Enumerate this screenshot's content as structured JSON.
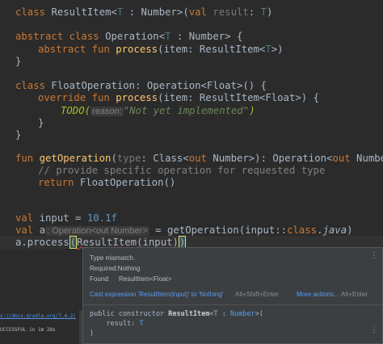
{
  "code": {
    "l1": {
      "kw1": "class",
      "name": "ResultItem",
      "lt": "<",
      "tp": "T",
      "colon": " : ",
      "bound": "Number",
      "gt": ">(",
      "kw2": "val",
      "param": " result",
      "ptype_sep": ": ",
      "ptype": "T",
      "close": ")"
    },
    "l2": {
      "kw": "abstract class",
      "name": "Operation",
      "lt": "<",
      "tp": "T",
      "rest": " : Number> {"
    },
    "l3": {
      "kw": "abstract fun",
      "fn": "process",
      "open": "(item: ResultItem<",
      "tp": "T",
      "close": ">)"
    },
    "l4": {
      "text": "}"
    },
    "l5": {
      "kw": "class",
      "text": " FloatOperation: Operation<Float>() {"
    },
    "l6": {
      "kw": "override fun",
      "fn": "process",
      "rest": "(item: ResultItem<Float>) {"
    },
    "l7": {
      "todo": "TODO(",
      "hint": "reason:",
      "str": "\"Not yet implemented\"",
      "close": ")"
    },
    "l8": {
      "text": "}"
    },
    "l9": {
      "text": "}"
    },
    "l10": {
      "kw": "fun",
      "fn": "getOperation",
      "open": "(",
      "param": "type",
      "mid": ": Class<",
      "kw2": "out",
      "mid2": " Number>): Operation<",
      "kw3": "out",
      "rest": " Number> -"
    },
    "l11": {
      "cmt": "// provide specific operation for requested type"
    },
    "l12": {
      "kw": "return",
      "rest": " FloatOperation()"
    },
    "l13": {
      "kw": "val",
      "rest": " input = ",
      "num": "10.1f"
    },
    "l14": {
      "kw": "val",
      "rest": " a",
      "hint": ": Operation<out Number>",
      "eq": " = getOperation(input::",
      "kw2": "class",
      "dot": ".",
      "it": "java",
      "close": ")"
    },
    "l15": {
      "pre": "a.process",
      "open": "(",
      "squig": "ResultItem(input)",
      "close": ")"
    }
  },
  "popup": {
    "title": "Type mismatch.",
    "required": "Required:Nothing",
    "found_label": "Found:",
    "found_value": "ResultItem<Float>",
    "action": "Cast expression 'ResultItem(input)' to 'Nothing'",
    "action_shortcut": "Alt+Shift+Enter",
    "more": "More actions...",
    "more_shortcut": "Alt+Enter",
    "sig1_pre": "public constructor ",
    "sig1_name": "ResultItem",
    "sig1_tp": "<T : ",
    "sig1_bound": "Number",
    "sig1_end": ">(",
    "sig2_pre": "    result: ",
    "sig2_tp": "T",
    "sig3": ")"
  },
  "run_panel": {
    "link": "s://docs.gradle.org/7.4.2/",
    "status": "UCCESSFUL in 1m 28s"
  }
}
